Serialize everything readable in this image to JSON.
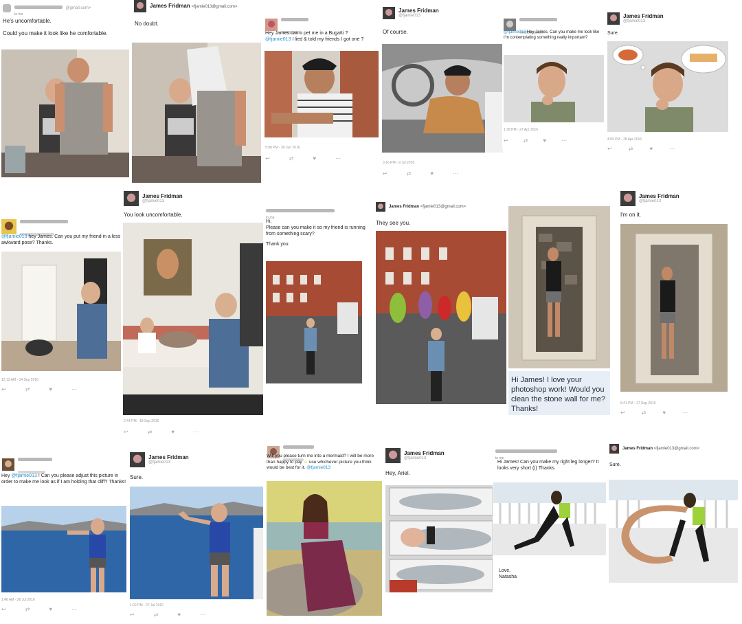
{
  "p1": {
    "email": "@gmail.com>",
    "to": "to me",
    "msg1": "He's uncomfortable.",
    "msg2": "Could you make it look like he comfortable."
  },
  "p2": {
    "name": "James Fridman",
    "email": "<fjamie013@gmail.com>",
    "msg": "No doubt."
  },
  "p3": {
    "msg1": "Hey James can u pet me in a Bugatti ?",
    "handle": "@fjamie013",
    "msg2": " I lied & told my friends I got one ?",
    "ts": "5:08 PM - 30 Jun 2016"
  },
  "p4": {
    "name": "James Fridman",
    "handle": "@fjamie013",
    "msg": "Of course.",
    "ts": "3:16 PM - 9 Jul 2016"
  },
  "p5": {
    "handle": "@fjamie013",
    "msg": " Hey James, Can you make me look like I'm contemplating something really important?",
    "ts": "1:38 PM - 27 Apr 2016"
  },
  "p6": {
    "name": "James Fridman",
    "handle": "@fjamie013",
    "msg": "Sure.",
    "ts": "4:09 PM - 28 Apr 2016"
  },
  "p7": {
    "handle": "@fjamie013",
    "msg": " hey James. Can you put my friend in a less awkward pose? Thanks.",
    "ts": "12:13 AM - 14 Sep 2016"
  },
  "p8": {
    "name": "James Fridman",
    "handle": "@fjamie013",
    "msg": "You look uncomfortable.",
    "ts": "2:44 PM - 18 Sep 2016"
  },
  "p9": {
    "to": "to me",
    "msg1": "Hi,",
    "msg2": "Please can you make it so my friend is running from something scary?",
    "msg3": "Thank you"
  },
  "p10": {
    "name": "James Fridman",
    "email": "<fjamie013@gmail.com>",
    "msg": "They see you."
  },
  "p11": {
    "bubble": "Hi James! I love your photoshop work! Would you clean the stone wall for me? Thanks!"
  },
  "p12": {
    "name": "James Fridman",
    "handle": "@fjamie013",
    "msg": "I'm on it.",
    "ts": "6:41 PM - 27 Sep 2016"
  },
  "p13": {
    "msg1": "Hey ",
    "handle": "@fjamie013",
    "msg2": " ! Can you please adjust this picture in order to make me look as if I am holding that cliff? Thanks!",
    "ts": "1:48 AM - 26 Jul 2016"
  },
  "p14": {
    "name": "James Fridman",
    "handle": "@fjamie013",
    "msg": "Sure.",
    "ts": "1:02 PM - 27 Jul 2016"
  },
  "p15": {
    "msg1": "Will you please turn me into a mermaid? I will be more than happy to pay",
    "msg2": " use whichever picture you think would be best for it.",
    "handle": "@fjamie013"
  },
  "p16": {
    "name": "James Fridman",
    "handle": "@fjamie013",
    "msg": "Hey, Ariel."
  },
  "p17": {
    "to": "to me",
    "msg": "Hi James! Can you make my right leg longer? It looks very short ((( Thanks.",
    "sign1": "Love,",
    "sign2": "Natasha"
  },
  "p18": {
    "name": "James Fridman",
    "email": "<fjamie013@gmail.com>",
    "msg": "Sure."
  }
}
